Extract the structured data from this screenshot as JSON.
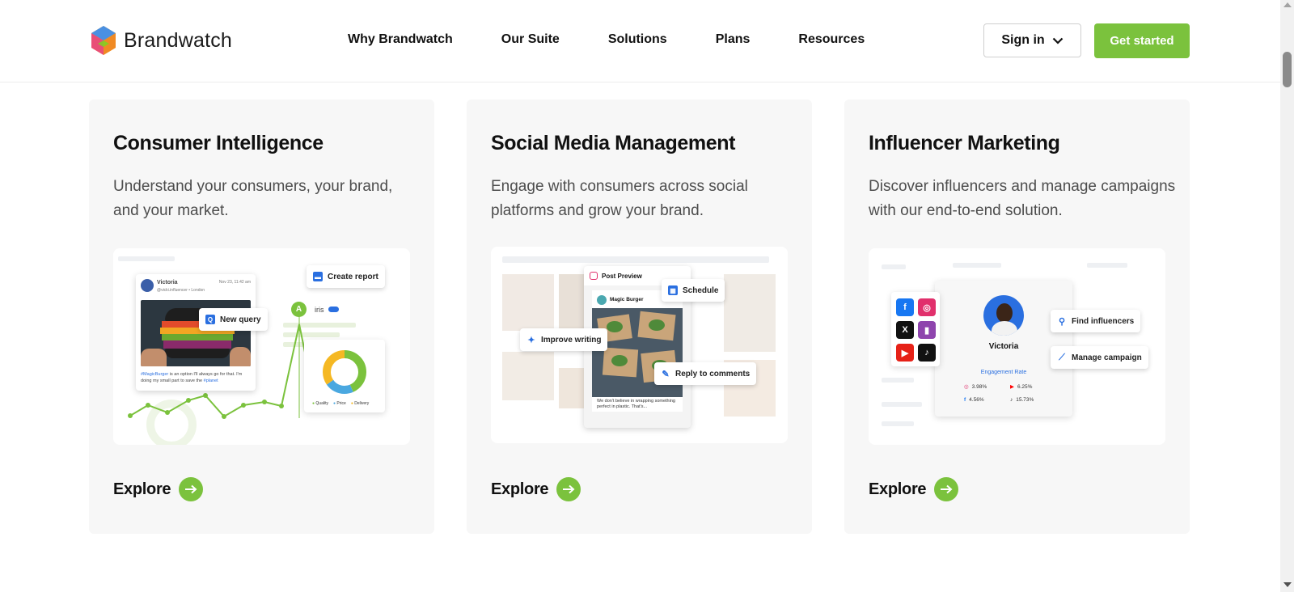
{
  "brand": {
    "name": "Brandwatch",
    "colors": [
      "#4a90e2",
      "#f5a623",
      "#e94e77",
      "#7ed321"
    ]
  },
  "nav": {
    "items": [
      "Why Brandwatch",
      "Our Suite",
      "Solutions",
      "Plans",
      "Resources"
    ]
  },
  "header": {
    "sign_in": "Sign in",
    "get_started": "Get started"
  },
  "colors": {
    "accent": "#7bc23d"
  },
  "cards": [
    {
      "title": "Consumer Intelligence",
      "description": "Understand your consumers, your brand, and your market.",
      "explore": "Explore",
      "illustration": {
        "post_user": "Victoria",
        "post_handle": "@vicki.influencer • London",
        "post_date": "Nov 23, 11:42 am",
        "post_text_1": "#MagicBurger",
        "post_text_2": " is an option I'll always go for that. I'm doing my small part to save the ",
        "post_text_3": "#planet",
        "new_query": "New query",
        "create_report": "Create report",
        "iris_badge": "A",
        "iris_label": "iris",
        "legend": [
          "Quality",
          "Price",
          "Delivery"
        ]
      }
    },
    {
      "title": "Social Media Management",
      "description": "Engage with consumers across social platforms and grow your brand.",
      "explore": "Explore",
      "illustration": {
        "post_preview": "Post Preview",
        "account": "Magic Burger",
        "caption": "We don't believe in wrapping something perfect in plastic. That's...",
        "schedule": "Schedule",
        "improve_writing": "Improve writing",
        "reply_to_comments": "Reply to comments"
      }
    },
    {
      "title": "Influencer Marketing",
      "description": "Discover influencers and manage campaigns with our end-to-end solution.",
      "explore": "Explore",
      "illustration": {
        "name": "Victoria",
        "engagement_label": "Engagement Rate",
        "stats": [
          "3.98%",
          "6.25%",
          "4.56%",
          "15.73%"
        ],
        "find_influencers": "Find influencers",
        "manage_campaign": "Manage campaign"
      }
    }
  ]
}
